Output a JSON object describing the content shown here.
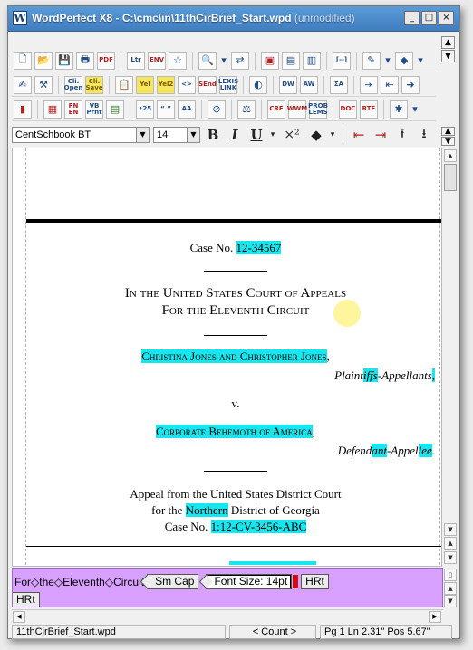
{
  "window": {
    "app_name": "WordPerfect X8",
    "separator": " - ",
    "file_path": "C:\\cmc\\in\\11thCirBrief_Start.wpd",
    "state": "(unmodified)",
    "controls": {
      "minimize": "_",
      "maximize": "□",
      "close": "×"
    }
  },
  "font_bar": {
    "font_name": "CentSchbook BT",
    "font_size": "14",
    "bold": "B",
    "italic": "I",
    "underline": "U",
    "superscript": "×²"
  },
  "document": {
    "case_number_label": "Case No.",
    "case_number_value": "12-34567",
    "court_line1": "In the United States Court of Appeals",
    "court_line2": "For the Eleventh Circuit",
    "plaintiffs_names": "Christina Jones and Christopher Jones",
    "plaintiffs_comma": ",",
    "plaintiffs_role_pre": "Plaint",
    "plaintiffs_role_hl1": "iffs",
    "plaintiffs_role_mid": "-Appellants",
    "plaintiffs_role_hl2": ",",
    "versus": "v.",
    "defendant_name": "Corporate Behemoth of America",
    "defendant_comma": ",",
    "defendant_role_pre": "Defend",
    "defendant_role_hl1": "ant",
    "defendant_role_mid": "-Appel",
    "defendant_role_hl2": "lee",
    "defendant_role_end": ".",
    "appeal_line1": "Appeal from the United States District Court",
    "appeal_line2_pre": "for the ",
    "appeal_line2_hl": "Northern",
    "appeal_line2_post": " District of Georgia",
    "lower_case_label": "Case No.",
    "lower_case_value": "1:12-CV-3456-ABC"
  },
  "reveal_codes": {
    "text": "For◇the◇Eleventh◇Circuit",
    "tag_smcap": "Sm Cap",
    "tag_fontsize": "Font Size: 14pt",
    "tag_hrt1": "HRt",
    "tag_hrt2": "HRt"
  },
  "status": {
    "filename": "11thCirBrief_Start.wpd",
    "count": "< Count >",
    "position": "Pg 1 Ln 2.31\" Pos 5.67\""
  },
  "colors": {
    "highlight": "#18e6ee",
    "reveal_bg": "#d8a0ff",
    "titlebar": "#4a8bcc"
  }
}
